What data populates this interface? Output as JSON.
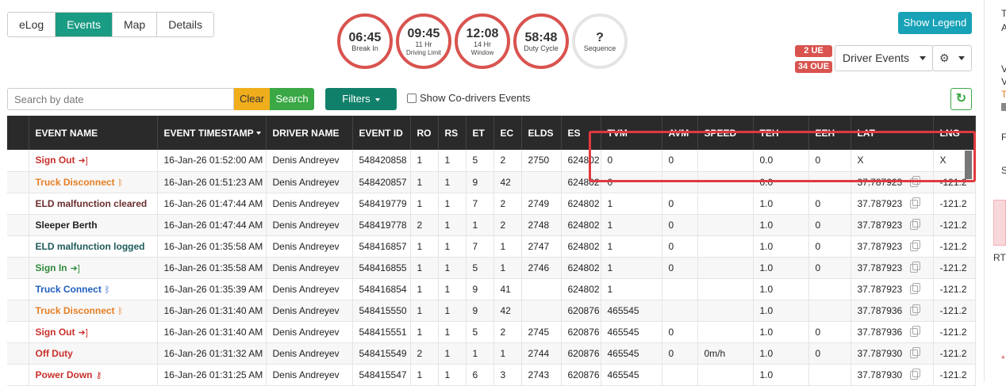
{
  "tabs": [
    {
      "label": "eLog",
      "active": false
    },
    {
      "label": "Events",
      "active": true
    },
    {
      "label": "Map",
      "active": false
    },
    {
      "label": "Details",
      "active": false
    }
  ],
  "timers": [
    {
      "value": "06:45",
      "label": "Break In",
      "sub": ""
    },
    {
      "value": "09:45",
      "label": "11 Hr",
      "sub": "Driving Limit"
    },
    {
      "value": "12:08",
      "label": "14 Hr",
      "sub": "Window"
    },
    {
      "value": "58:48",
      "label": "Duty Cycle",
      "sub": ""
    },
    {
      "value": "?",
      "label": "Sequence",
      "sub": ""
    }
  ],
  "legend_label": "Show Legend",
  "badges": {
    "ue": "2 UE",
    "oue": "34 OUE"
  },
  "driver_select": "Driver Events",
  "search": {
    "placeholder": "Search by date",
    "clear": "Clear",
    "search": "Search"
  },
  "filters_label": "Filters",
  "codrivers_label": "Show Co-drivers Events",
  "columns": [
    "",
    "EVENT NAME",
    "EVENT TIMESTAMP",
    "DRIVER NAME",
    "EVENT ID",
    "RO",
    "RS",
    "ET",
    "EC",
    "ELDS",
    "ES",
    "TVM",
    "AVM",
    "SPEED",
    "TEH",
    "EEH",
    "LAT",
    "LNG"
  ],
  "rows": [
    {
      "name": "Sign Out",
      "icon": "sign-out-icon",
      "color": "#c9302c",
      "ts": "16-Jan-26 01:52:00 AM",
      "driver": "Denis Andreyev",
      "id": "548420858",
      "ro": "1",
      "rs": "1",
      "et": "5",
      "ec": "2",
      "elds": "2750",
      "es": "624802",
      "tvm": "0",
      "avm": "0",
      "speed": "",
      "teh": "0.0",
      "eeh": "0",
      "lat": "X",
      "copy": false,
      "lng": "X"
    },
    {
      "name": "Truck Disconnect",
      "icon": "bluetooth-icon",
      "color": "#e67e22",
      "ts": "16-Jan-26 01:51:23 AM",
      "driver": "Denis Andreyev",
      "id": "548420857",
      "ro": "1",
      "rs": "1",
      "et": "9",
      "ec": "42",
      "elds": "",
      "es": "624802",
      "tvm": "0",
      "avm": "",
      "speed": "",
      "teh": "0.0",
      "eeh": "",
      "lat": "37.787923",
      "copy": true,
      "lng": "-121.2"
    },
    {
      "name": "ELD malfunction cleared",
      "icon": "",
      "color": "#6b2d2d",
      "ts": "16-Jan-26 01:47:44 AM",
      "driver": "Denis Andreyev",
      "id": "548419779",
      "ro": "1",
      "rs": "1",
      "et": "7",
      "ec": "2",
      "elds": "2749",
      "es": "624802",
      "tvm": "1",
      "avm": "0",
      "speed": "",
      "teh": "1.0",
      "eeh": "0",
      "lat": "37.787923",
      "copy": true,
      "lng": "-121.2"
    },
    {
      "name": "Sleeper Berth",
      "icon": "",
      "color": "#222222",
      "ts": "16-Jan-26 01:47:44 AM",
      "driver": "Denis Andreyev",
      "id": "548419778",
      "ro": "2",
      "rs": "1",
      "et": "1",
      "ec": "2",
      "elds": "2748",
      "es": "624802",
      "tvm": "1",
      "avm": "0",
      "speed": "",
      "teh": "1.0",
      "eeh": "0",
      "lat": "37.787923",
      "copy": true,
      "lng": "-121.2"
    },
    {
      "name": "ELD malfunction logged",
      "icon": "",
      "color": "#1e5a5a",
      "ts": "16-Jan-26 01:35:58 AM",
      "driver": "Denis Andreyev",
      "id": "548416857",
      "ro": "1",
      "rs": "1",
      "et": "7",
      "ec": "1",
      "elds": "2747",
      "es": "624802",
      "tvm": "1",
      "avm": "0",
      "speed": "",
      "teh": "1.0",
      "eeh": "0",
      "lat": "37.787923",
      "copy": true,
      "lng": "-121.2"
    },
    {
      "name": "Sign In",
      "icon": "sign-in-icon",
      "color": "#2e8b3a",
      "ts": "16-Jan-26 01:35:58 AM",
      "driver": "Denis Andreyev",
      "id": "548416855",
      "ro": "1",
      "rs": "1",
      "et": "5",
      "ec": "1",
      "elds": "2746",
      "es": "624802",
      "tvm": "1",
      "avm": "0",
      "speed": "",
      "teh": "1.0",
      "eeh": "0",
      "lat": "37.787923",
      "copy": true,
      "lng": "-121.2"
    },
    {
      "name": "Truck Connect",
      "icon": "bluetooth-icon",
      "color": "#1f5fbf",
      "ts": "16-Jan-26 01:35:39 AM",
      "driver": "Denis Andreyev",
      "id": "548416854",
      "ro": "1",
      "rs": "1",
      "et": "9",
      "ec": "41",
      "elds": "",
      "es": "624802",
      "tvm": "1",
      "avm": "",
      "speed": "",
      "teh": "1.0",
      "eeh": "",
      "lat": "37.787923",
      "copy": true,
      "lng": "-121.2"
    },
    {
      "name": "Truck Disconnect",
      "icon": "bluetooth-icon",
      "color": "#e67e22",
      "ts": "16-Jan-26 01:31:40 AM",
      "driver": "Denis Andreyev",
      "id": "548415550",
      "ro": "1",
      "rs": "1",
      "et": "9",
      "ec": "42",
      "elds": "",
      "es": "620876",
      "tvm": "465545",
      "avm": "",
      "speed": "",
      "teh": "1.0",
      "eeh": "",
      "lat": "37.787936",
      "copy": true,
      "lng": "-121.2"
    },
    {
      "name": "Sign Out",
      "icon": "sign-out-icon",
      "color": "#c9302c",
      "ts": "16-Jan-26 01:31:40 AM",
      "driver": "Denis Andreyev",
      "id": "548415551",
      "ro": "1",
      "rs": "1",
      "et": "5",
      "ec": "2",
      "elds": "2745",
      "es": "620876",
      "tvm": "465545",
      "avm": "0",
      "speed": "",
      "teh": "1.0",
      "eeh": "0",
      "lat": "37.787936",
      "copy": true,
      "lng": "-121.2"
    },
    {
      "name": "Off Duty",
      "icon": "",
      "color": "#c9302c",
      "ts": "16-Jan-26 01:31:32 AM",
      "driver": "Denis Andreyev",
      "id": "548415549",
      "ro": "2",
      "rs": "1",
      "et": "1",
      "ec": "1",
      "elds": "2744",
      "es": "620876",
      "tvm": "465545",
      "avm": "0",
      "speed": "0m/h",
      "teh": "1.0",
      "eeh": "0",
      "lat": "37.787930",
      "copy": true,
      "lng": "-121.2"
    },
    {
      "name": "Power Down",
      "icon": "key-icon",
      "color": "#c9302c",
      "ts": "16-Jan-26 01:31:25 AM",
      "driver": "Denis Andreyev",
      "id": "548415547",
      "ro": "1",
      "rs": "1",
      "et": "6",
      "ec": "3",
      "elds": "2743",
      "es": "620876",
      "tvm": "465545",
      "avm": "",
      "speed": "",
      "teh": "1.0",
      "eeh": "",
      "lat": "37.787930",
      "copy": true,
      "lng": "-121.2"
    }
  ],
  "right_panel": {
    "texts": [
      "T",
      "A",
      "V",
      "V",
      "T",
      "F",
      "S",
      "RT",
      "*"
    ]
  },
  "colors": {
    "accent": "#1a9b83",
    "danger": "#d9534f",
    "legend": "#17a2b8",
    "highlight": "#e0393e"
  }
}
